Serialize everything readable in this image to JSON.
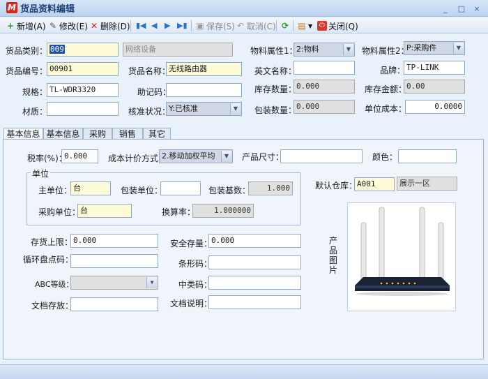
{
  "window": {
    "title": "货品资料编辑",
    "logo_letter": "M"
  },
  "window_controls": {
    "minimize": "_",
    "restore": "□",
    "close": "×"
  },
  "toolbar": {
    "add": "新增(A)",
    "edit": "修改(E)",
    "delete": "删除(D)",
    "save": "保存(S)",
    "cancel": "取消(C)",
    "close": "关闭(Q)"
  },
  "fields": {
    "category_label": "货品类别：",
    "category_code": "009",
    "category_name": "网络设备",
    "attr1_label": "物料属性1：",
    "attr1_value": "2:物料",
    "attr2_label": "物料属性2：",
    "attr2_value": "P:采购件",
    "code_label": "货品编号：",
    "code_value": "00901",
    "name_label": "货品名称：",
    "name_value": "无线路由器",
    "en_name_label": "英文名称：",
    "en_name_value": "",
    "brand_label": "品牌：",
    "brand_value": "TP-LINK",
    "spec_label": "规格：",
    "spec_value": "TL-WDR3320",
    "memo_code_label": "助记码：",
    "memo_code_value": "",
    "stock_qty_label": "库存数量：",
    "stock_qty_value": "0.000",
    "stock_amt_label": "库存金额：",
    "stock_amt_value": "0.00",
    "material_label": "材质：",
    "material_value": "",
    "approval_label": "核准状况：",
    "approval_value": "Y:已核准",
    "pack_qty_label": "包装数量：",
    "pack_qty_value": "0.000",
    "unit_cost_label": "单位成本：",
    "unit_cost_value": "0.0000"
  },
  "tabs": [
    "基本信息1",
    "基本信息2",
    "采购",
    "销售",
    "其它"
  ],
  "tab_panel": {
    "tax_label": "税率(%)：",
    "tax_value": "0.000",
    "cost_method_label": "成本计价方式：",
    "cost_method_value": "2.移动加权平均",
    "size_label": "产品尺寸：",
    "size_value": "",
    "color_label": "颜色：",
    "color_value": "",
    "unit_group_title": "单位",
    "main_unit_label": "主单位：",
    "main_unit_value": "台",
    "pack_unit_label": "包装单位：",
    "pack_unit_value": "",
    "pack_base_label": "包装基数：",
    "pack_base_value": "1.000",
    "purchase_unit_label": "采购单位：",
    "purchase_unit_value": "台",
    "conv_rate_label": "换算率：",
    "conv_rate_value": "1.000000",
    "warehouse_label": "默认仓库：",
    "warehouse_code": "A001",
    "warehouse_name": "展示一区",
    "max_stock_label": "存货上限：",
    "max_stock_value": "0.000",
    "safe_stock_label": "安全存量：",
    "safe_stock_value": "0.000",
    "cycle_code_label": "循环盘点码：",
    "cycle_code_value": "",
    "barcode_label": "条形码：",
    "barcode_value": "",
    "abc_label": "ABC等级：",
    "abc_value": "",
    "mid_code_label": "中类码：",
    "mid_code_value": "",
    "doc_store_label": "文档存放：",
    "doc_store_value": "",
    "doc_desc_label": "文档说明：",
    "doc_desc_value": "",
    "photo_label": "产品图片"
  },
  "colors": {
    "title_text": "#1c3f73",
    "logo": "#d9261c",
    "highlight": "#1e4fa8",
    "router_body": "#1b2233"
  }
}
